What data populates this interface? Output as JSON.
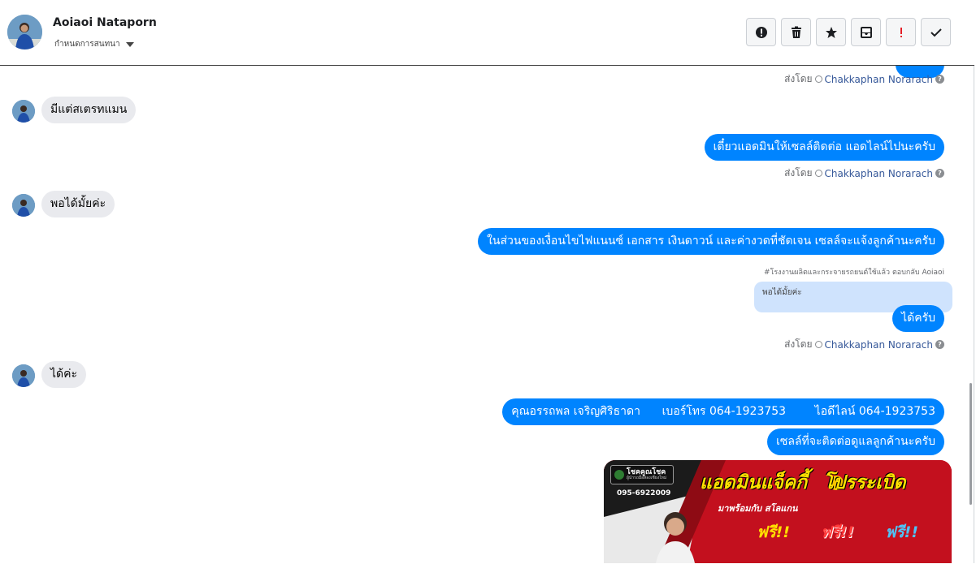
{
  "header": {
    "contact_name": "Aoiaoi Nataporn",
    "assign_label": "กำหนดการสนทนา",
    "actions": [
      {
        "name": "spam-icon"
      },
      {
        "name": "trash-icon"
      },
      {
        "name": "star-icon"
      },
      {
        "name": "archive-icon"
      },
      {
        "name": "important-icon"
      },
      {
        "name": "check-icon"
      }
    ]
  },
  "chat": {
    "sent_by_prefix": "ส่งโดย",
    "agent_name": "Chakkaphan Norarach",
    "messages": [
      {
        "dir": "in",
        "text": "มีแต่สเตรทแมน"
      },
      {
        "dir": "out",
        "text": "เดี๋ยวแอดมินให้เซลล์ติดต่อ แอดไลน์ไปนะครับ"
      },
      {
        "dir": "in",
        "text": "พอได้มั้ยค่ะ"
      },
      {
        "dir": "out",
        "text": "ในส่วนของเงื่อนไขไฟแนนซ์ เอกสาร เงินดาวน์ และค่างวดที่ชัดเจน เซลล์จะแจ้งลูกค้านะครับ"
      },
      {
        "dir": "out",
        "text": "ได้ครับ",
        "reply_label": "#โรงงานผลิตและกระจายรถยนต์ใช้แล้ว ตอบกลับ Aoiaoi",
        "quoted": "พอได้มั้ยค่ะ"
      },
      {
        "dir": "in",
        "text": "ได้ค่ะ"
      },
      {
        "dir": "out",
        "text": "คุณอรรถพล เจริญศิริธาดา      เบอร์โทร 064-1923753        ไอดีไลน์ 064-1923753"
      },
      {
        "dir": "out",
        "text": "เซลล์ที่จะติดต่อดูแลลูกค้านะครับ"
      }
    ],
    "banner": {
      "logo_text": "โชคคูณโชค",
      "logo_sub": "ผู้นำรถมือสองเชียงใหม่",
      "phone": "095-6922009",
      "headline": "แอดมินแจ็คกี้",
      "headline2": "โปรระเบิด",
      "subline": "มาพร้อมกับ สโลแกน",
      "free": [
        "ฟรี!!",
        "ฟรี!!",
        "ฟรี!!"
      ]
    }
  },
  "colors": {
    "outgoing": "#0084ff",
    "incoming": "#e9eaee",
    "banner": "#b81420"
  }
}
